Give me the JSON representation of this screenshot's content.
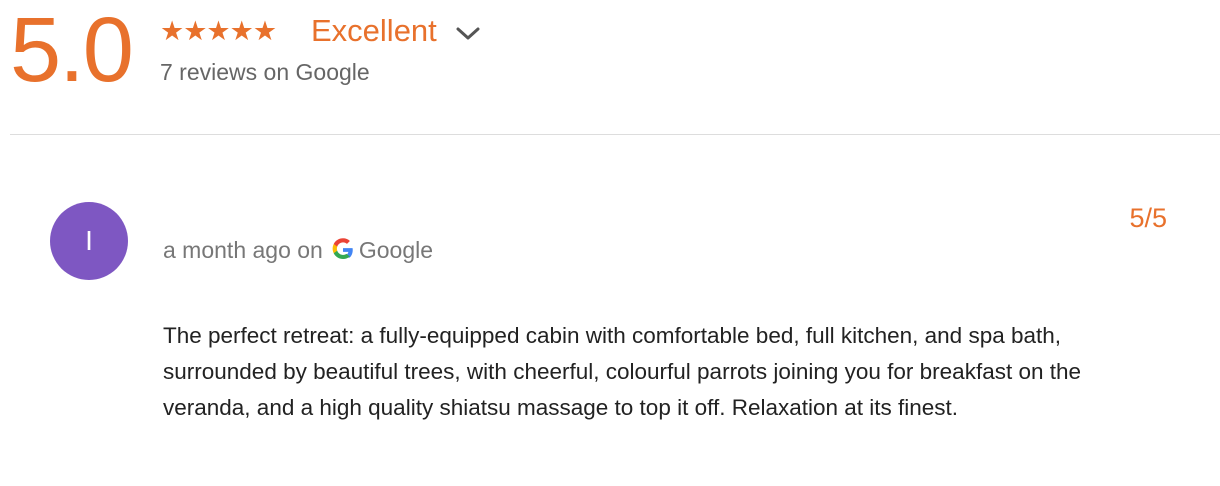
{
  "summary": {
    "score": "5.0",
    "stars": "★★★★★",
    "rating_label": "Excellent",
    "review_count": "7 reviews on Google",
    "icon": "chevron-down-icon",
    "accent_color": "#e8712c"
  },
  "review": {
    "avatar_initial": "I",
    "avatar_color": "#7e57c2",
    "time_prefix": "a month ago on",
    "source": "Google",
    "source_icon": "google-g-icon",
    "score": "5/5",
    "text": "The perfect retreat: a fully-equipped cabin with comfortable bed, full kitchen, and spa bath, surrounded by beautiful trees, with cheerful, colourful parrots joining you for breakfast on the veranda, and a high quality shiatsu massage to top it off. Relaxation at its finest."
  }
}
